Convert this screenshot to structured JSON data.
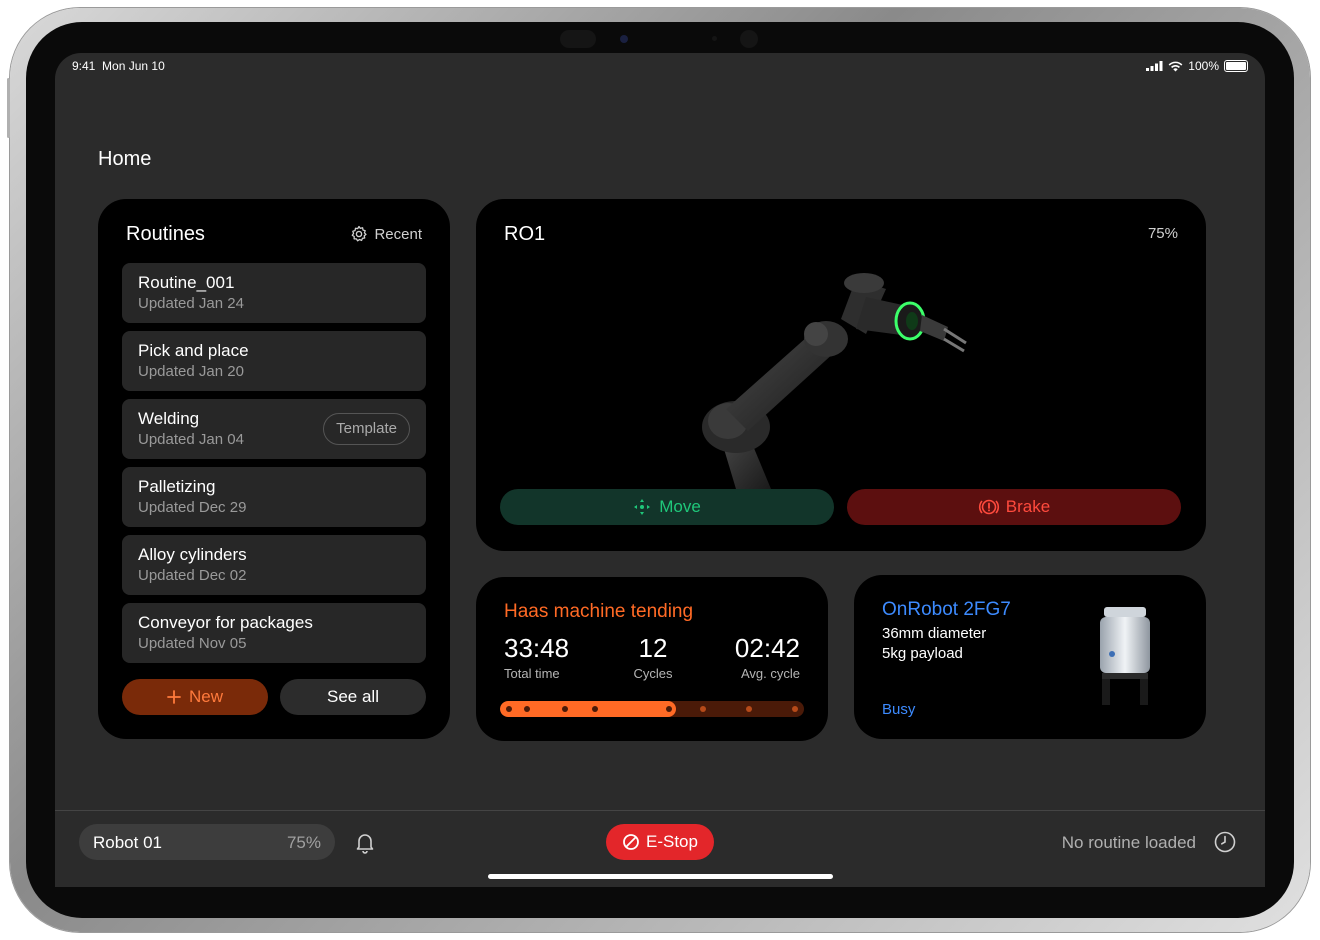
{
  "status_bar": {
    "time": "9:41",
    "date": "Mon Jun 10",
    "battery": "100%"
  },
  "page": {
    "title": "Home"
  },
  "routines": {
    "title": "Routines",
    "sort_label": "Recent",
    "items": [
      {
        "name": "Routine_001",
        "updated": "Updated Jan 24",
        "tag": ""
      },
      {
        "name": "Pick and place",
        "updated": "Updated Jan 20",
        "tag": ""
      },
      {
        "name": "Welding",
        "updated": "Updated Jan 04",
        "tag": "Template"
      },
      {
        "name": "Palletizing",
        "updated": "Updated Dec 29",
        "tag": ""
      },
      {
        "name": "Alloy cylinders",
        "updated": "Updated Dec 02",
        "tag": ""
      },
      {
        "name": "Conveyor for packages",
        "updated": "Updated Nov 05",
        "tag": ""
      }
    ],
    "new_label": "New",
    "see_all_label": "See all"
  },
  "robot": {
    "name": "RO1",
    "battery": "75%",
    "move_label": "Move",
    "brake_label": "Brake",
    "move_color": "#1fc77a",
    "brake_color": "#ff4a3d"
  },
  "job": {
    "title": "Haas machine tending",
    "total_time": "33:48",
    "total_time_label": "Total time",
    "cycles": "12",
    "cycles_label": "Cycles",
    "avg_cycle": "02:42",
    "avg_cycle_label": "Avg. cycle",
    "progress": 0.58,
    "accent": "#ff6a25"
  },
  "gripper": {
    "name": "OnRobot 2FG7",
    "detail1": "36mm diameter",
    "detail2": "5kg payload",
    "status": "Busy",
    "brand_logo": "onrobot",
    "accent": "#3d8bff"
  },
  "bottom_bar": {
    "robot_name": "Robot 01",
    "robot_battery": "75%",
    "estop_label": "E-Stop",
    "routine_status": "No routine loaded",
    "estop_color": "#e3262a"
  }
}
